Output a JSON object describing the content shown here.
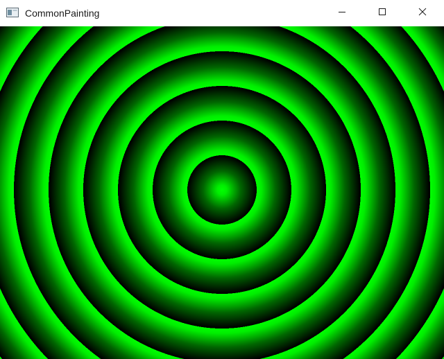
{
  "window": {
    "title": "CommonPainting"
  },
  "icons": {
    "app": "app-window-icon",
    "minimize": "minimize-icon",
    "maximize": "maximize-icon",
    "close": "close-icon"
  },
  "canvas": {
    "pattern": "concentric-radial-gradient-rings",
    "colors": {
      "bright": "#00ff00",
      "dark": "#000000"
    }
  }
}
